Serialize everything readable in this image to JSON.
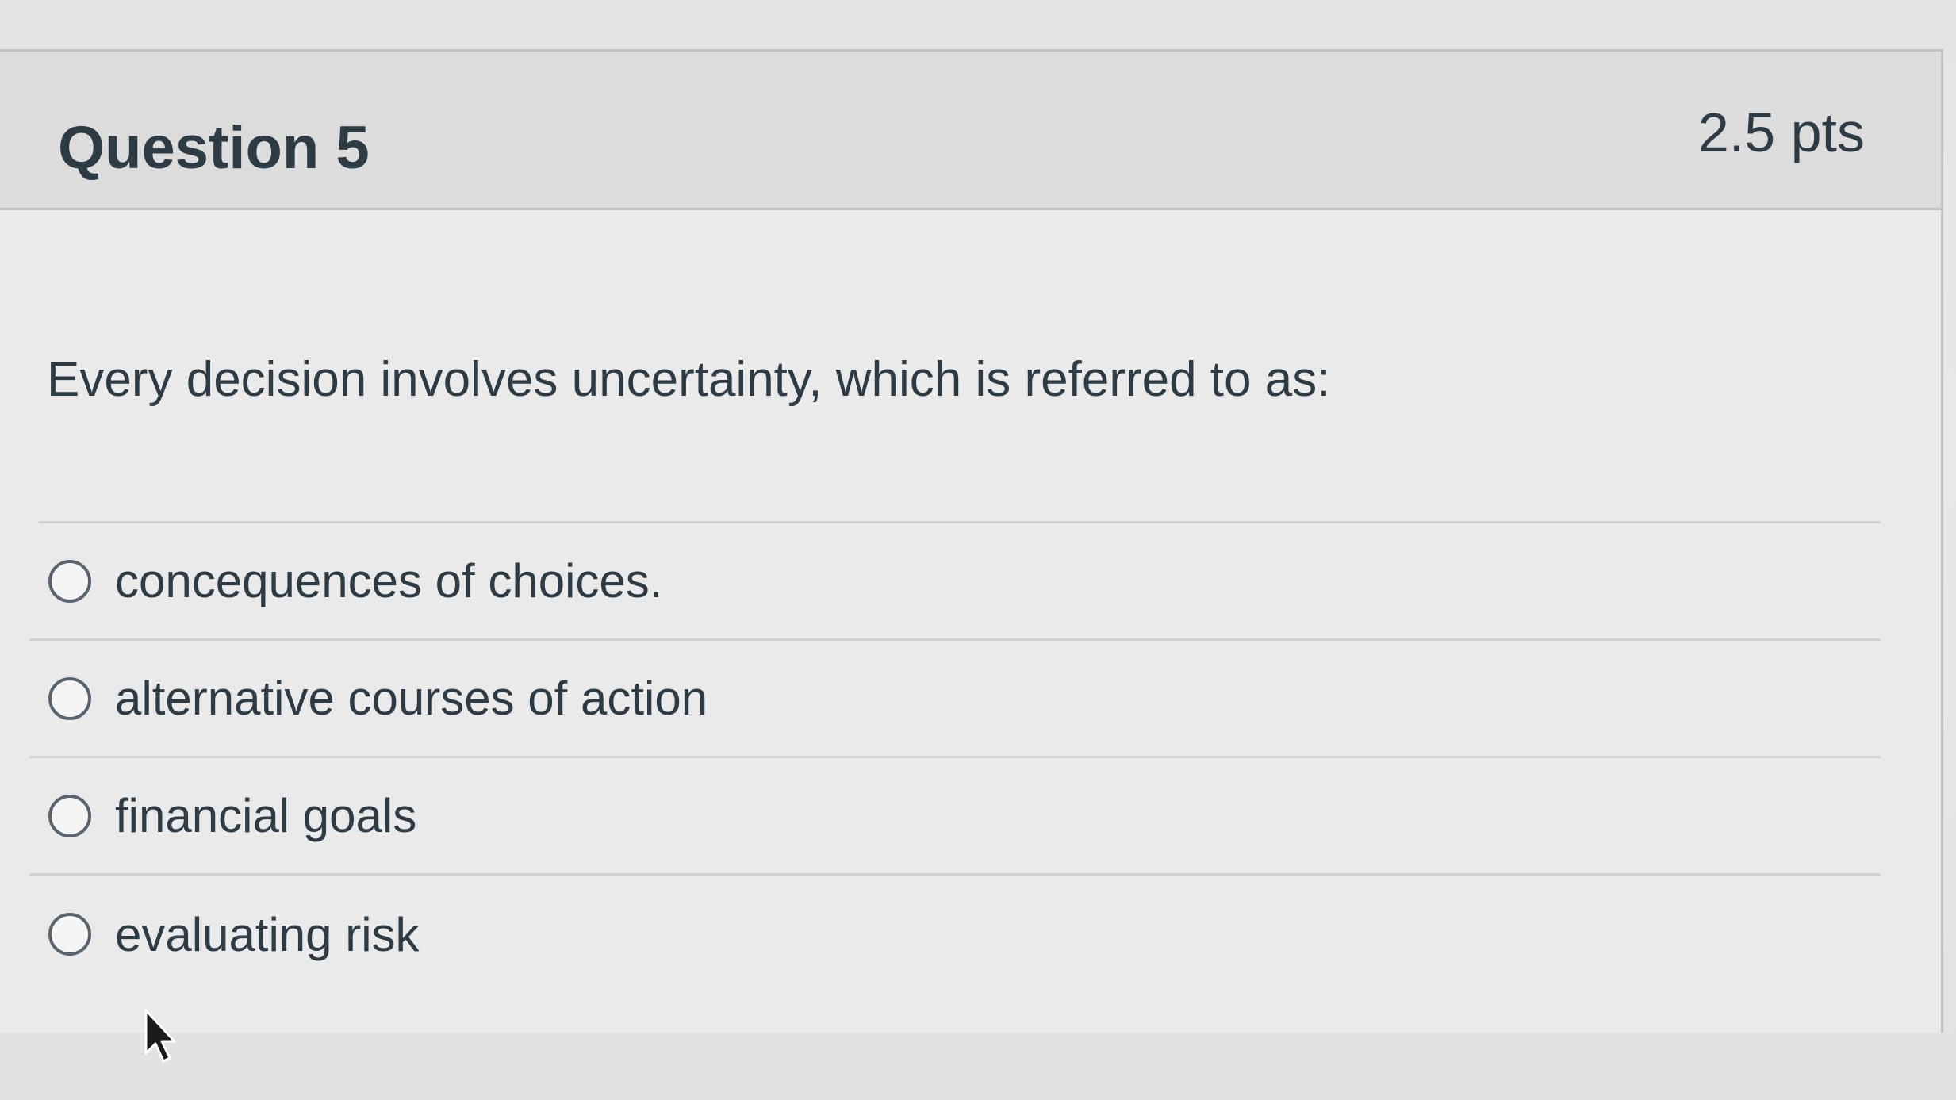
{
  "question": {
    "title": "Question 5",
    "points": "2.5 pts",
    "text": "Every decision involves uncertainty, which is referred to as:",
    "answers": [
      {
        "label": "concequences of choices."
      },
      {
        "label": "alternative courses of action"
      },
      {
        "label": "financial goals"
      },
      {
        "label": "evaluating risk"
      }
    ]
  },
  "icons": {
    "radio": "radio-button-icon",
    "cursor": "mouse-pointer-icon"
  },
  "colors": {
    "text": "#2d3b45",
    "header_bg": "#dcdcdc",
    "body_bg": "#eaeaea",
    "border": "#c4c4c4"
  }
}
